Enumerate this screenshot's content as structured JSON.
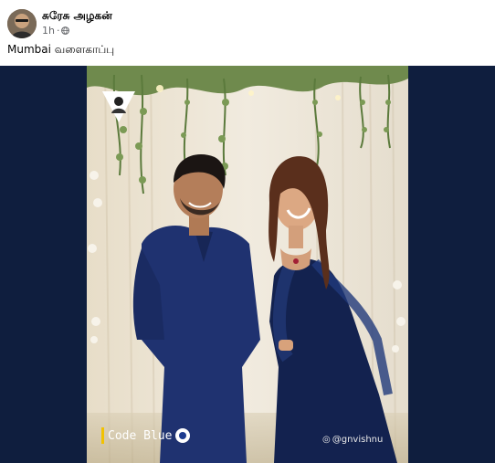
{
  "post": {
    "author": "சுரேசு அழகன்",
    "time": "1h",
    "separator": "·",
    "caption": "Mumbai வளைகாப்பு"
  },
  "image": {
    "watermark_brand": "Code Blue",
    "instagram_handle": "@gnvishnu",
    "instagram_prefix": "◎"
  },
  "icons": {
    "privacy": "globe-icon",
    "avatar": "profile-avatar"
  },
  "colors": {
    "media_background": "#0f1e3e",
    "name_text": "#050505",
    "meta_text": "#65676b"
  }
}
